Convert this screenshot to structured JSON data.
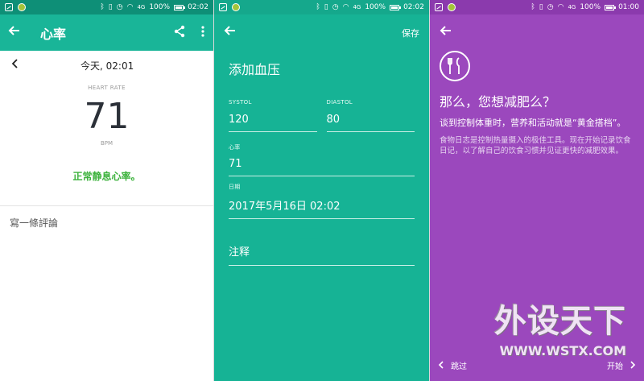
{
  "screens": {
    "heart_rate": {
      "status_time": "02:02",
      "battery": "100%",
      "signal": "4G",
      "title": "心率",
      "date": "今天, 02:01",
      "label": "HEART RATE",
      "value": "71",
      "unit": "BPM",
      "status_text": "正常静息心率。",
      "comment": "寫一條評論",
      "colors": {
        "appbar": "#19b598",
        "status_ok": "#3cb23c"
      }
    },
    "add_bp": {
      "status_time": "02:02",
      "battery": "100%",
      "signal": "4G",
      "save": "保存",
      "title": "添加血压",
      "systol_label": "SYSTOL",
      "systol_value": "120",
      "diastol_label": "DIASTOL",
      "diastol_value": "80",
      "hr_label": "心率",
      "hr_value": "71",
      "date_label": "日期",
      "date_value": "2017年5月16日 02:02",
      "note": "注释",
      "colors": {
        "background": "#16b395"
      }
    },
    "diet": {
      "status_time": "01:00",
      "battery": "100%",
      "signal": "4G",
      "heading": "那么，您想减肥么？",
      "subheading": "谈到控制体重时，营养和活动就是“黄金搭档”。",
      "body": "食物日志是控制热量摄入的极佳工具。现在开始记录饮食日记，以了解自己的饮食习惯并见证更快的减肥效果。",
      "skip": "跳过",
      "start": "开始",
      "colors": {
        "background": "#9b48bd"
      }
    }
  },
  "watermark": {
    "big": "外设天下",
    "small": "WWW.WSTX.COM"
  }
}
